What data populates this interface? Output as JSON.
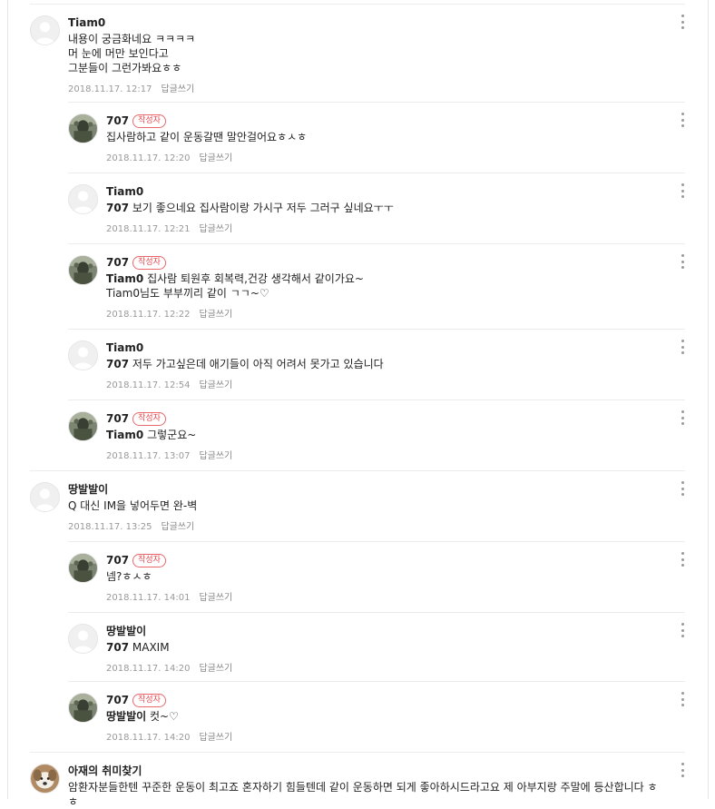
{
  "comments": [
    {
      "type": "top",
      "author": "Tiam0",
      "badge": "",
      "mention": "",
      "text": "내용이 궁금화네요 ㅋㅋㅋㅋ\n머 눈에 머만 보인다고\n그분들이 그런가봐요ㅎㅎ",
      "date": "2018.11.17. 12:17",
      "reply_label": "답글쓰기",
      "avatar": "default-avatar"
    },
    {
      "type": "reply",
      "author": "707",
      "badge": "작성자",
      "mention": "",
      "text": "집사람하고 같이 운동갈땐 말안걸어요ㅎㅅㅎ",
      "date": "2018.11.17. 12:20",
      "reply_label": "답글쓰기",
      "avatar": "photo-avatar"
    },
    {
      "type": "reply",
      "author": "Tiam0",
      "badge": "",
      "mention": "707",
      "text": "보기 좋으네요 집사람이랑 가시구 저두 그러구 싶네요ㅜㅜ",
      "date": "2018.11.17. 12:21",
      "reply_label": "답글쓰기",
      "avatar": "default-avatar"
    },
    {
      "type": "reply",
      "author": "707",
      "badge": "작성자",
      "mention": "Tiam0",
      "text": "집사람 퇴원후 회복력,건강 생각해서 같이가요~\nTiam0님도 부부끼리 같이 ㄱㄱ~♡",
      "date": "2018.11.17. 12:22",
      "reply_label": "답글쓰기",
      "avatar": "photo-avatar"
    },
    {
      "type": "reply",
      "author": "Tiam0",
      "badge": "",
      "mention": "707",
      "text": "저두 가고싶은데 애기들이 아직 어려서 못가고 있습니다",
      "date": "2018.11.17. 12:54",
      "reply_label": "답글쓰기",
      "avatar": "default-avatar"
    },
    {
      "type": "reply",
      "author": "707",
      "badge": "작성자",
      "mention": "Tiam0",
      "text": "그렇군요~",
      "date": "2018.11.17. 13:07",
      "reply_label": "답글쓰기",
      "avatar": "photo-avatar"
    },
    {
      "type": "top",
      "author": "땅발발이",
      "badge": "",
      "mention": "",
      "text": "Q 대신 IM을 넣어두면 완-벽",
      "date": "2018.11.17. 13:25",
      "reply_label": "답글쓰기",
      "avatar": "default-avatar"
    },
    {
      "type": "reply",
      "author": "707",
      "badge": "작성자",
      "mention": "",
      "text": "넴?ㅎㅅㅎ",
      "date": "2018.11.17. 14:01",
      "reply_label": "답글쓰기",
      "avatar": "photo-avatar"
    },
    {
      "type": "reply",
      "author": "땅발발이",
      "badge": "",
      "mention": "707",
      "text": "MAXIM",
      "date": "2018.11.17. 14:20",
      "reply_label": "답글쓰기",
      "avatar": "default-avatar"
    },
    {
      "type": "reply",
      "author": "707",
      "badge": "작성자",
      "mention": "땅발발이",
      "text": "컷~♡",
      "date": "2018.11.17. 14:20",
      "reply_label": "답글쓰기",
      "avatar": "photo-avatar"
    },
    {
      "type": "top",
      "author": "아재의 취미찾기",
      "badge": "",
      "mention": "",
      "text": "암환자분들한텐 꾸준한 운동이 최고죠 혼자하기 힘들텐데 같이 운동하면 되게 좋아하시드라고요 제 아부지랑 주말에 등산합니다 ㅎㅎ",
      "date": "",
      "reply_label": "",
      "avatar": "dog-avatar"
    }
  ]
}
